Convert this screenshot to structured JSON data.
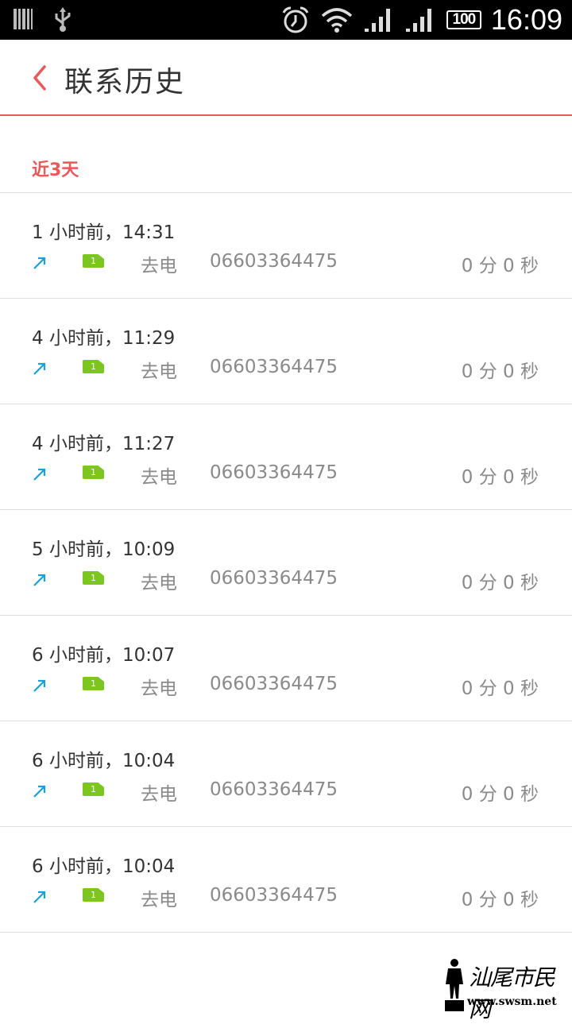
{
  "status_bar": {
    "time": "16:09",
    "battery": "100",
    "icons": [
      "barcode-icon",
      "usb-icon",
      "alarm-icon",
      "wifi-icon",
      "signal-icon",
      "signal-icon",
      "battery-icon"
    ]
  },
  "header": {
    "back_icon": "chevron-left-icon",
    "title": "联系历史"
  },
  "section": {
    "label": "近3天"
  },
  "calls": [
    {
      "time": "1 小时前，14:31",
      "sim": "1",
      "type": "去电",
      "number": "06603364475",
      "duration": "0 分 0 秒"
    },
    {
      "time": "4 小时前，11:29",
      "sim": "1",
      "type": "去电",
      "number": "06603364475",
      "duration": "0 分 0 秒"
    },
    {
      "time": "4 小时前，11:27",
      "sim": "1",
      "type": "去电",
      "number": "06603364475",
      "duration": "0 分 0 秒"
    },
    {
      "time": "5 小时前，10:09",
      "sim": "1",
      "type": "去电",
      "number": "06603364475",
      "duration": "0 分 0 秒"
    },
    {
      "time": "6 小时前，10:07",
      "sim": "1",
      "type": "去电",
      "number": "06603364475",
      "duration": "0 分 0 秒"
    },
    {
      "time": "6 小时前，10:04",
      "sim": "1",
      "type": "去电",
      "number": "06603364475",
      "duration": "0 分 0 秒"
    },
    {
      "time": "6 小时前，10:04",
      "sim": "1",
      "type": "去电",
      "number": "06603364475",
      "duration": "0 分 0 秒"
    }
  ],
  "colors": {
    "accent": "#e9585a",
    "outgoing_arrow": "#1aa0d8",
    "sim_badge": "#7dc51f",
    "secondary_text": "#8a8a8a"
  },
  "watermark": {
    "text": "汕尾市民网",
    "url": "www.swsm.net"
  }
}
